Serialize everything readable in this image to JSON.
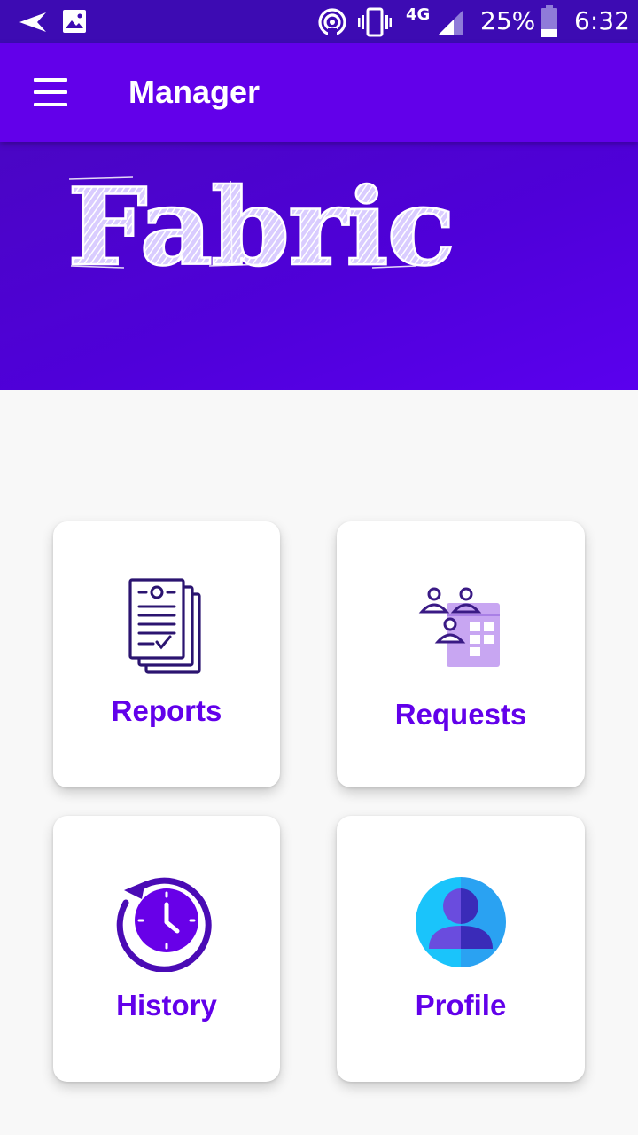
{
  "status_bar": {
    "network": "4G",
    "battery": "25%",
    "time": "6:32"
  },
  "app_bar": {
    "title": "Manager",
    "menu_icon": "hamburger-menu-icon"
  },
  "banner": {
    "logo_text": "Fabric"
  },
  "dashboard": {
    "cards": [
      {
        "label": "Reports",
        "icon": "reports-icon"
      },
      {
        "label": "Requests",
        "icon": "requests-icon"
      },
      {
        "label": "History",
        "icon": "history-icon"
      },
      {
        "label": "Profile",
        "icon": "profile-icon"
      }
    ]
  },
  "colors": {
    "status_bar": "#3d0bb3",
    "primary": "#6200ea",
    "banner": "#5000dd",
    "card_label": "#6200ea",
    "background": "#f8f8f8"
  }
}
